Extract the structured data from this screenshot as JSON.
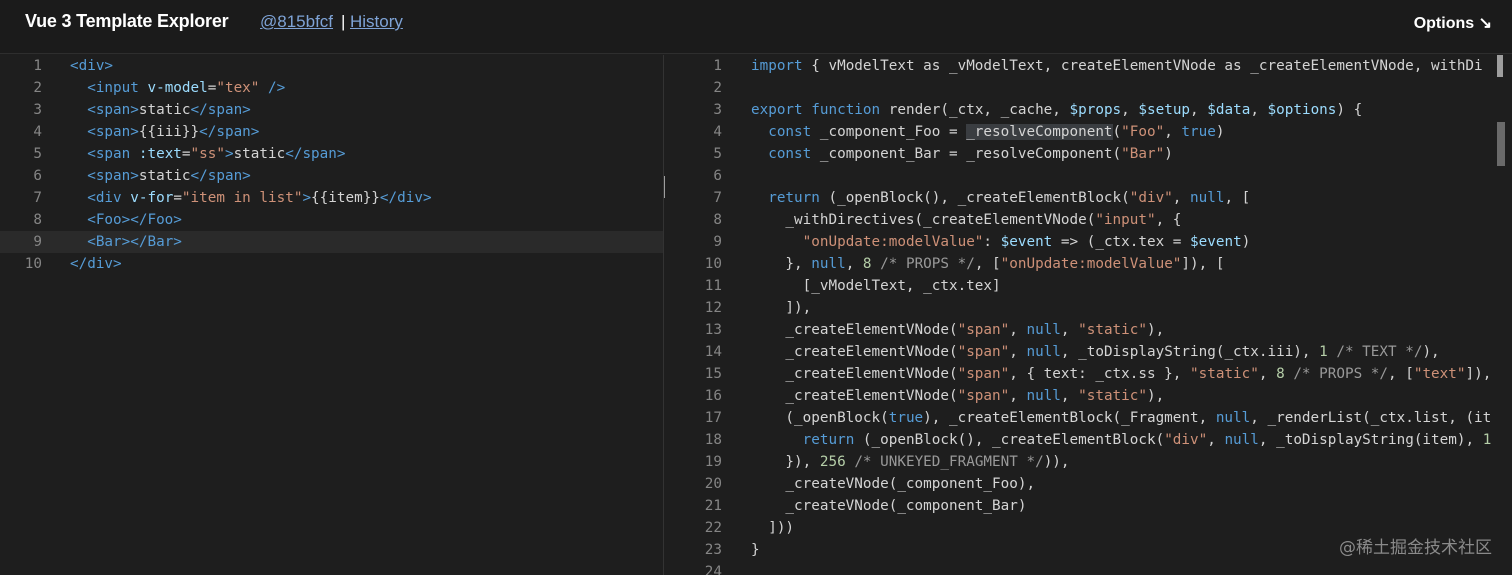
{
  "header": {
    "title": "Vue 3 Template Explorer",
    "commit": "@815bfcf",
    "separator": "|",
    "history": "History",
    "options": "Options ↘"
  },
  "template_pane": {
    "lines": [
      {
        "n": "1",
        "t": [
          [
            "tag",
            "<div>"
          ]
        ]
      },
      {
        "n": "2",
        "t": [
          [
            "pl",
            "  "
          ],
          [
            "tag",
            "<input "
          ],
          [
            "attr",
            "v-model"
          ],
          [
            "pl",
            "="
          ],
          [
            "str",
            "\"tex\""
          ],
          [
            "tag",
            " />"
          ]
        ]
      },
      {
        "n": "3",
        "t": [
          [
            "pl",
            "  "
          ],
          [
            "tag",
            "<span>"
          ],
          [
            "pl",
            "static"
          ],
          [
            "tag",
            "</span>"
          ]
        ]
      },
      {
        "n": "4",
        "t": [
          [
            "pl",
            "  "
          ],
          [
            "tag",
            "<span>"
          ],
          [
            "pl",
            "{{iii}}"
          ],
          [
            "tag",
            "</span>"
          ]
        ]
      },
      {
        "n": "5",
        "t": [
          [
            "pl",
            "  "
          ],
          [
            "tag",
            "<span "
          ],
          [
            "attr",
            ":text"
          ],
          [
            "pl",
            "="
          ],
          [
            "str",
            "\"ss\""
          ],
          [
            "tag",
            ">"
          ],
          [
            "pl",
            "static"
          ],
          [
            "tag",
            "</span>"
          ]
        ]
      },
      {
        "n": "6",
        "t": [
          [
            "pl",
            "  "
          ],
          [
            "tag",
            "<span>"
          ],
          [
            "pl",
            "static"
          ],
          [
            "tag",
            "</span>"
          ]
        ]
      },
      {
        "n": "7",
        "t": [
          [
            "pl",
            "  "
          ],
          [
            "tag",
            "<div "
          ],
          [
            "attr",
            "v-for"
          ],
          [
            "pl",
            "="
          ],
          [
            "str",
            "\"item in list\""
          ],
          [
            "tag",
            ">"
          ],
          [
            "pl",
            "{{item}}"
          ],
          [
            "tag",
            "</div>"
          ]
        ]
      },
      {
        "n": "8",
        "t": [
          [
            "pl",
            "  "
          ],
          [
            "tag",
            "<Foo></Foo>"
          ]
        ]
      },
      {
        "n": "9",
        "t": [
          [
            "pl",
            "  "
          ],
          [
            "tag",
            "<Bar>"
          ],
          [
            "tag",
            "</Bar>"
          ]
        ]
      },
      {
        "n": "10",
        "t": [
          [
            "tag",
            "</div>"
          ]
        ]
      }
    ]
  },
  "output_pane": {
    "lines": [
      {
        "n": "1",
        "t": [
          [
            "kw",
            "import"
          ],
          [
            "pl",
            " { vModelText as _vModelText, createElementVNode as _createElementVNode, withDi"
          ]
        ]
      },
      {
        "n": "2",
        "t": []
      },
      {
        "n": "3",
        "t": [
          [
            "kw",
            "export"
          ],
          [
            "pl",
            " "
          ],
          [
            "kw",
            "function"
          ],
          [
            "pl",
            " render(_ctx, _cache, "
          ],
          [
            "rdol",
            "$props"
          ],
          [
            "pl",
            ", "
          ],
          [
            "rdol",
            "$setup"
          ],
          [
            "pl",
            ", "
          ],
          [
            "rdol",
            "$data"
          ],
          [
            "pl",
            ", "
          ],
          [
            "rdol",
            "$options"
          ],
          [
            "pl",
            ") {"
          ]
        ]
      },
      {
        "n": "4",
        "t": [
          [
            "pl",
            "  "
          ],
          [
            "kw",
            "const"
          ],
          [
            "pl",
            " _component_Foo = "
          ],
          [
            "sel",
            "_resolveComponent"
          ],
          [
            "pl",
            "("
          ],
          [
            "rstr",
            "\"Foo\""
          ],
          [
            "pl",
            ", "
          ],
          [
            "rtrue",
            "true"
          ],
          [
            "pl",
            ")"
          ]
        ]
      },
      {
        "n": "5",
        "t": [
          [
            "pl",
            "  "
          ],
          [
            "kw",
            "const"
          ],
          [
            "pl",
            " _component_Bar = _resolveComponent("
          ],
          [
            "rstr",
            "\"Bar\""
          ],
          [
            "pl",
            ")"
          ]
        ]
      },
      {
        "n": "6",
        "t": []
      },
      {
        "n": "7",
        "t": [
          [
            "pl",
            "  "
          ],
          [
            "kw",
            "return"
          ],
          [
            "pl",
            " (_openBlock(), _createElementBlock("
          ],
          [
            "rstr",
            "\"div\""
          ],
          [
            "pl",
            ", "
          ],
          [
            "rnull",
            "null"
          ],
          [
            "pl",
            ", ["
          ]
        ]
      },
      {
        "n": "8",
        "t": [
          [
            "pl",
            "    _withDirectives(_createElementVNode("
          ],
          [
            "rstr",
            "\"input\""
          ],
          [
            "pl",
            ", {"
          ]
        ]
      },
      {
        "n": "9",
        "t": [
          [
            "pl",
            "      "
          ],
          [
            "rstr",
            "\"onUpdate:modelValue\""
          ],
          [
            "pl",
            ": "
          ],
          [
            "rdol",
            "$event"
          ],
          [
            "pl",
            " => (_ctx.tex = "
          ],
          [
            "rdol",
            "$event"
          ],
          [
            "pl",
            ")"
          ]
        ]
      },
      {
        "n": "10",
        "t": [
          [
            "pl",
            "    }, "
          ],
          [
            "rnull",
            "null"
          ],
          [
            "pl",
            ", "
          ],
          [
            "rnum",
            "8"
          ],
          [
            "pl",
            " "
          ],
          [
            "rcmt",
            "/* PROPS */"
          ],
          [
            "pl",
            ", ["
          ],
          [
            "rstr",
            "\"onUpdate:modelValue\""
          ],
          [
            "pl",
            "]), ["
          ]
        ]
      },
      {
        "n": "11",
        "t": [
          [
            "pl",
            "      [_vModelText, _ctx.tex]"
          ]
        ]
      },
      {
        "n": "12",
        "t": [
          [
            "pl",
            "    ]),"
          ]
        ]
      },
      {
        "n": "13",
        "t": [
          [
            "pl",
            "    _createElementVNode("
          ],
          [
            "rstr",
            "\"span\""
          ],
          [
            "pl",
            ", "
          ],
          [
            "rnull",
            "null"
          ],
          [
            "pl",
            ", "
          ],
          [
            "rstr",
            "\"static\""
          ],
          [
            "pl",
            "),"
          ]
        ]
      },
      {
        "n": "14",
        "t": [
          [
            "pl",
            "    _createElementVNode("
          ],
          [
            "rstr",
            "\"span\""
          ],
          [
            "pl",
            ", "
          ],
          [
            "rnull",
            "null"
          ],
          [
            "pl",
            ", _toDisplayString(_ctx.iii), "
          ],
          [
            "rnum",
            "1"
          ],
          [
            "pl",
            " "
          ],
          [
            "rcmt",
            "/* TEXT */"
          ],
          [
            "pl",
            "),"
          ]
        ]
      },
      {
        "n": "15",
        "t": [
          [
            "pl",
            "    _createElementVNode("
          ],
          [
            "rstr",
            "\"span\""
          ],
          [
            "pl",
            ", { text: _ctx.ss }, "
          ],
          [
            "rstr",
            "\"static\""
          ],
          [
            "pl",
            ", "
          ],
          [
            "rnum",
            "8"
          ],
          [
            "pl",
            " "
          ],
          [
            "rcmt",
            "/* PROPS */"
          ],
          [
            "pl",
            ", ["
          ],
          [
            "rstr",
            "\"text\""
          ],
          [
            "pl",
            "]),"
          ]
        ]
      },
      {
        "n": "16",
        "t": [
          [
            "pl",
            "    _createElementVNode("
          ],
          [
            "rstr",
            "\"span\""
          ],
          [
            "pl",
            ", "
          ],
          [
            "rnull",
            "null"
          ],
          [
            "pl",
            ", "
          ],
          [
            "rstr",
            "\"static\""
          ],
          [
            "pl",
            "),"
          ]
        ]
      },
      {
        "n": "17",
        "t": [
          [
            "pl",
            "    (_openBlock("
          ],
          [
            "rtrue",
            "true"
          ],
          [
            "pl",
            "), _createElementBlock(_Fragment, "
          ],
          [
            "rnull",
            "null"
          ],
          [
            "pl",
            ", _renderList(_ctx.list, (it"
          ]
        ]
      },
      {
        "n": "18",
        "t": [
          [
            "pl",
            "      "
          ],
          [
            "kw",
            "return"
          ],
          [
            "pl",
            " (_openBlock(), _createElementBlock("
          ],
          [
            "rstr",
            "\"div\""
          ],
          [
            "pl",
            ", "
          ],
          [
            "rnull",
            "null"
          ],
          [
            "pl",
            ", _toDisplayString(item), "
          ],
          [
            "rnum",
            "1"
          ]
        ]
      },
      {
        "n": "19",
        "t": [
          [
            "pl",
            "    }), "
          ],
          [
            "rnum",
            "256"
          ],
          [
            "pl",
            " "
          ],
          [
            "rcmt",
            "/* UNKEYED_FRAGMENT */"
          ],
          [
            "pl",
            ")),"
          ]
        ]
      },
      {
        "n": "20",
        "t": [
          [
            "pl",
            "    _createVNode(_component_Foo),"
          ]
        ]
      },
      {
        "n": "21",
        "t": [
          [
            "pl",
            "    _createVNode(_component_Bar)"
          ]
        ]
      },
      {
        "n": "22",
        "t": [
          [
            "pl",
            "  ]))"
          ]
        ]
      },
      {
        "n": "23",
        "t": [
          [
            "pl",
            "}"
          ]
        ]
      },
      {
        "n": "24",
        "t": []
      }
    ]
  },
  "watermark": "@稀土掘金技术社区",
  "colors": {
    "background": "#1e1e1e",
    "header_bg": "#1b1b1b",
    "link": "#7ea3d6",
    "keyword": "#569cd6",
    "string": "#ce9178",
    "number": "#b5cea8",
    "attribute": "#9cdcfe",
    "line_number": "#858585"
  }
}
